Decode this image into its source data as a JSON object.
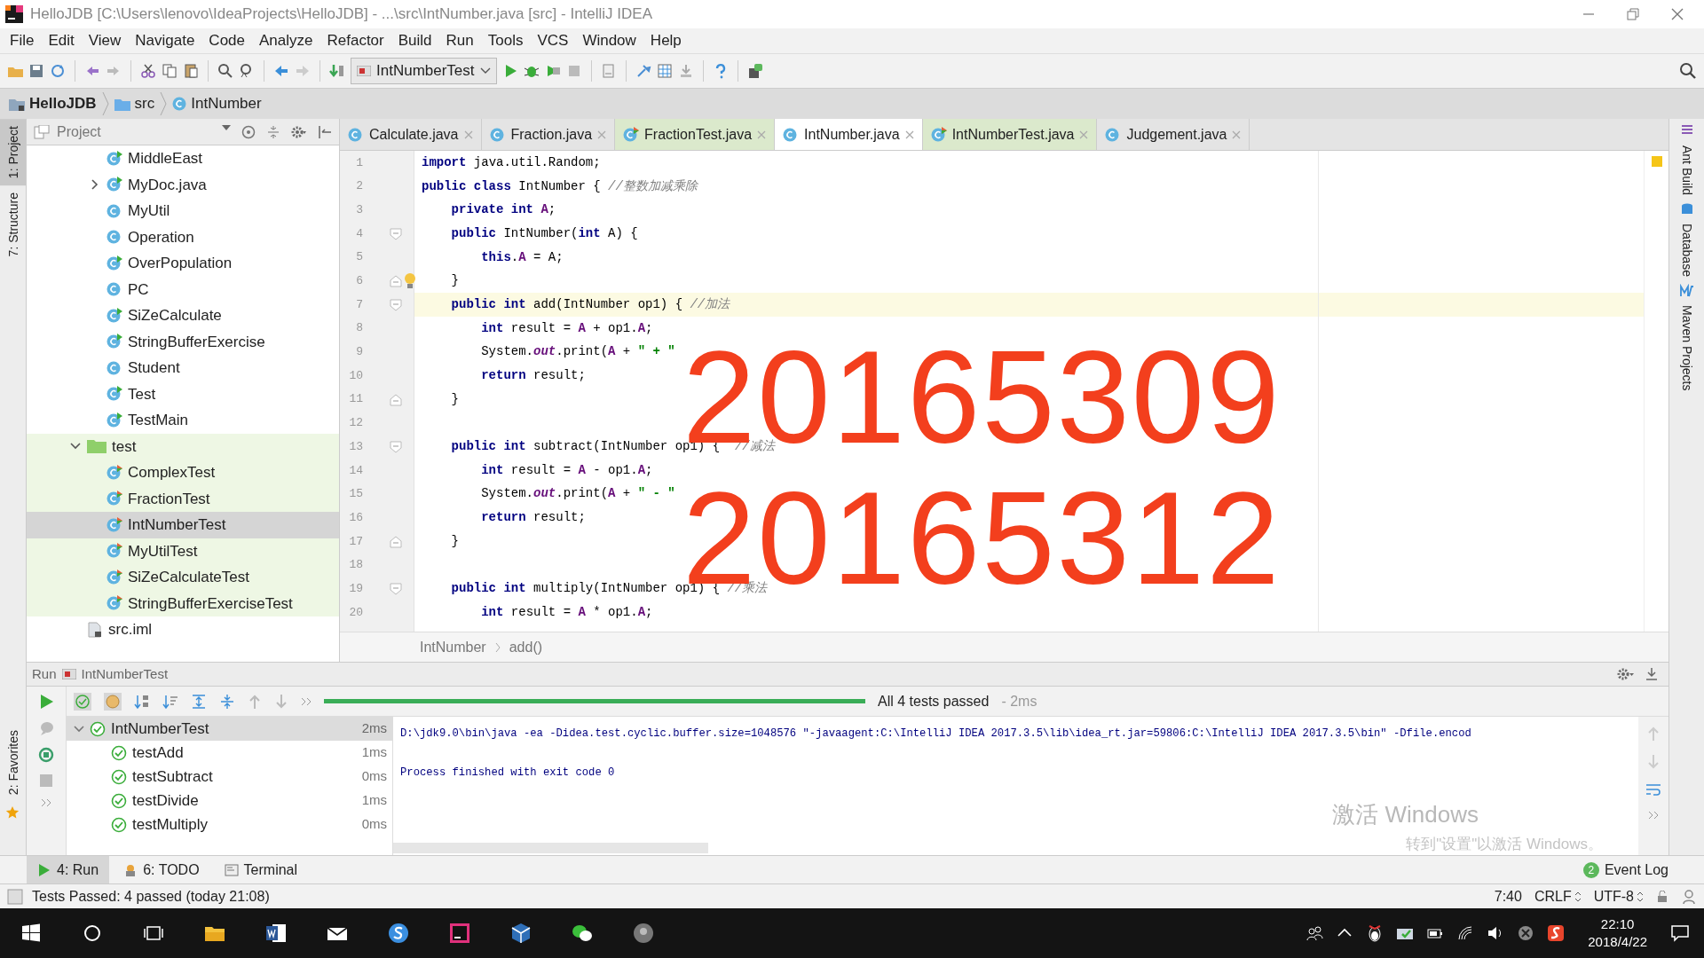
{
  "window": {
    "title": "HelloJDB [C:\\Users\\lenovo\\IdeaProjects\\HelloJDB] - ...\\src\\IntNumber.java [src] - IntelliJ IDEA"
  },
  "menu": [
    "File",
    "Edit",
    "View",
    "Navigate",
    "Code",
    "Analyze",
    "Refactor",
    "Build",
    "Run",
    "Tools",
    "VCS",
    "Window",
    "Help"
  ],
  "toolbar": {
    "run_config": "IntNumberTest"
  },
  "navigation": [
    "HelloJDB",
    "src",
    "IntNumber"
  ],
  "left_tool_windows": [
    {
      "label": "1: Project",
      "selected": true
    },
    {
      "label": "7: Structure",
      "selected": false
    }
  ],
  "left_tool_windows_bottom": [
    {
      "label": "2: Favorites",
      "selected": false
    }
  ],
  "right_tool_windows": [
    "Ant Build",
    "Database",
    "Maven Projects"
  ],
  "project": {
    "title": "Project",
    "tree_continued": [
      {
        "label": "MiddleEast",
        "kind": "runnable",
        "selected": false
      },
      {
        "label": "MyDoc.java",
        "kind": "runnable",
        "selected": false,
        "expanded": false
      },
      {
        "label": "MyUtil",
        "kind": "class",
        "selected": false
      },
      {
        "label": "Operation",
        "kind": "class",
        "selected": false
      },
      {
        "label": "OverPopulation",
        "kind": "runnable",
        "selected": false
      },
      {
        "label": "PC",
        "kind": "class",
        "selected": false
      },
      {
        "label": "SiZeCalculate",
        "kind": "runnable",
        "selected": false
      },
      {
        "label": "StringBufferExercise",
        "kind": "runnable",
        "selected": false
      },
      {
        "label": "Student",
        "kind": "class",
        "selected": false
      },
      {
        "label": "Test",
        "kind": "runnable",
        "selected": false
      },
      {
        "label": "TestMain",
        "kind": "runnable",
        "selected": false
      }
    ],
    "tree": [
      {
        "label": "test",
        "kind": "test_folder",
        "selected": false,
        "expanded": true,
        "children": [
          {
            "label": "ComplexTest",
            "kind": "test",
            "selected": false
          },
          {
            "label": "FractionTest",
            "kind": "test",
            "selected": false
          },
          {
            "label": "IntNumberTest",
            "kind": "test",
            "selected": true
          },
          {
            "label": "MyUtilTest",
            "kind": "test",
            "selected": false
          },
          {
            "label": "SiZeCalculateTest",
            "kind": "test",
            "selected": false
          },
          {
            "label": "StringBufferExerciseTest",
            "kind": "test",
            "selected": false
          }
        ]
      },
      {
        "label": "src.iml",
        "kind": "file",
        "selected": false
      }
    ]
  },
  "tabs": [
    {
      "label": "Calculate.java",
      "kind": "source",
      "selected": false
    },
    {
      "label": "Fraction.java",
      "kind": "source",
      "selected": false
    },
    {
      "label": "FractionTest.java",
      "kind": "test",
      "selected": false
    },
    {
      "label": "IntNumber.java",
      "kind": "source",
      "selected": true
    },
    {
      "label": "IntNumberTest.java",
      "kind": "test",
      "selected": false
    },
    {
      "label": "Judgement.java",
      "kind": "source",
      "selected": false
    }
  ],
  "editor": {
    "lines": [
      {
        "number": "1",
        "tokens": [
          {
            "kind": "kw",
            "text": "import"
          },
          {
            "kind": "plain",
            "text": " java.util.Random;"
          }
        ]
      },
      {
        "number": "2",
        "tokens": [
          {
            "kind": "kw",
            "text": "public class"
          },
          {
            "kind": "plain",
            "text": " IntNumber { "
          },
          {
            "kind": "comment",
            "text": "//整数加减乘除"
          }
        ]
      },
      {
        "number": "3",
        "tokens": [
          {
            "kind": "kw",
            "text": "    private int"
          },
          {
            "kind": "field",
            "text": " A"
          },
          {
            "kind": "plain",
            "text": ";"
          }
        ]
      },
      {
        "number": "4",
        "fold_start": true,
        "tokens": [
          {
            "kind": "kw",
            "text": "    public"
          },
          {
            "kind": "plain",
            "text": " IntNumber("
          },
          {
            "kind": "kw",
            "text": "int"
          },
          {
            "kind": "plain",
            "text": " A) {"
          }
        ]
      },
      {
        "number": "5",
        "tokens": [
          {
            "kind": "kw",
            "text": "        this"
          },
          {
            "kind": "plain",
            "text": "."
          },
          {
            "kind": "field",
            "text": "A"
          },
          {
            "kind": "plain",
            "text": " = A;"
          }
        ]
      },
      {
        "number": "6",
        "fold_end": true,
        "bulb": true,
        "tokens": [
          {
            "kind": "plain",
            "text": "    }"
          }
        ]
      },
      {
        "number": "7",
        "fold_start": true,
        "current": true,
        "tokens": [
          {
            "kind": "kw",
            "text": "    public int"
          },
          {
            "kind": "plain",
            "text": " add(IntNumber op1) { "
          },
          {
            "kind": "comment",
            "text": "//加法"
          }
        ]
      },
      {
        "number": "8",
        "tokens": [
          {
            "kind": "kw",
            "text": "        int"
          },
          {
            "kind": "plain",
            "text": " result = "
          },
          {
            "kind": "field",
            "text": "A"
          },
          {
            "kind": "plain",
            "text": " + op1."
          },
          {
            "kind": "field",
            "text": "A"
          },
          {
            "kind": "plain",
            "text": ";"
          }
        ]
      },
      {
        "number": "9",
        "tokens": [
          {
            "kind": "plain",
            "text": "        System."
          },
          {
            "kind": "static",
            "text": "out"
          },
          {
            "kind": "plain",
            "text": ".print("
          },
          {
            "kind": "field",
            "text": "A"
          },
          {
            "kind": "plain",
            "text": " + "
          },
          {
            "kind": "str",
            "text": "\" + \""
          }
        ]
      },
      {
        "number": "10",
        "tokens": [
          {
            "kind": "kw",
            "text": "        return"
          },
          {
            "kind": "plain",
            "text": " result;"
          }
        ]
      },
      {
        "number": "11",
        "fold_end": true,
        "tokens": [
          {
            "kind": "plain",
            "text": "    }"
          }
        ]
      },
      {
        "number": "12"
      },
      {
        "number": "13",
        "fold_start": true,
        "tokens": [
          {
            "kind": "kw",
            "text": "    public int"
          },
          {
            "kind": "plain",
            "text": " subtract(IntNumber op1) {  "
          },
          {
            "kind": "comment",
            "text": "//减法"
          }
        ]
      },
      {
        "number": "14",
        "tokens": [
          {
            "kind": "kw",
            "text": "        int"
          },
          {
            "kind": "plain",
            "text": " result = "
          },
          {
            "kind": "field",
            "text": "A"
          },
          {
            "kind": "plain",
            "text": " - op1."
          },
          {
            "kind": "field",
            "text": "A"
          },
          {
            "kind": "plain",
            "text": ";"
          }
        ]
      },
      {
        "number": "15",
        "tokens": [
          {
            "kind": "plain",
            "text": "        System."
          },
          {
            "kind": "static",
            "text": "out"
          },
          {
            "kind": "plain",
            "text": ".print("
          },
          {
            "kind": "field",
            "text": "A"
          },
          {
            "kind": "plain",
            "text": " + "
          },
          {
            "kind": "str",
            "text": "\" - \""
          }
        ]
      },
      {
        "number": "16",
        "tokens": [
          {
            "kind": "kw",
            "text": "        return"
          },
          {
            "kind": "plain",
            "text": " result;"
          }
        ]
      },
      {
        "number": "17",
        "fold_end": true,
        "tokens": [
          {
            "kind": "plain",
            "text": "    }"
          }
        ]
      },
      {
        "number": "18"
      },
      {
        "number": "19",
        "fold_start": true,
        "tokens": [
          {
            "kind": "kw",
            "text": "    public int"
          },
          {
            "kind": "plain",
            "text": " multiply(IntNumber op1) { "
          },
          {
            "kind": "comment",
            "text": "//乘法"
          }
        ]
      },
      {
        "number": "20",
        "tokens": [
          {
            "kind": "kw",
            "text": "        int"
          },
          {
            "kind": "plain",
            "text": " result = "
          },
          {
            "kind": "field",
            "text": "A"
          },
          {
            "kind": "plain",
            "text": " * op1."
          },
          {
            "kind": "field",
            "text": "A"
          },
          {
            "kind": "plain",
            "text": ";"
          }
        ]
      }
    ],
    "breadcrumb": [
      "IntNumber",
      "add()"
    ]
  },
  "overlay_numbers": [
    "20165309",
    "20165312"
  ],
  "run": {
    "title": "Run",
    "config": "IntNumberTest",
    "level": 1,
    "summary": "All 4 tests passed",
    "duration": "- 2ms",
    "tree": {
      "label": "IntNumberTest",
      "time": "2ms",
      "expanded": true,
      "selected": true,
      "children": [
        {
          "label": "testAdd",
          "time": "1ms",
          "selected": false
        },
        {
          "label": "testSubtract",
          "time": "0ms",
          "selected": false
        },
        {
          "label": "testDivide",
          "time": "1ms",
          "selected": false
        },
        {
          "label": "testMultiply",
          "time": "0ms",
          "selected": false
        }
      ]
    },
    "console": [
      "D:\\jdk9.0\\bin\\java -ea -Didea.test.cyclic.buffer.size=1048576 \"-javaagent:C:\\IntelliJ IDEA 2017.3.5\\lib\\idea_rt.jar=59806:C:\\IntelliJ IDEA 2017.3.5\\bin\" -Dfile.encod",
      "Process finished with exit code 0"
    ]
  },
  "bottom_tabs": [
    {
      "label": "4: Run",
      "selected": true
    },
    {
      "label": "6: TODO",
      "selected": false
    },
    {
      "label": "Terminal",
      "selected": false
    }
  ],
  "event_log": {
    "count": "2",
    "label": "Event Log"
  },
  "activation": [
    "激活 Windows",
    "转到\"设置\"以激活 Windows。"
  ],
  "status": {
    "message": "Tests Passed: 4 passed (today 21:08)",
    "position": "7:40",
    "line_separator": "CRLF",
    "encoding": "UTF-8"
  },
  "taskbar": {
    "time": "22:10",
    "date": "2018/4/22"
  }
}
